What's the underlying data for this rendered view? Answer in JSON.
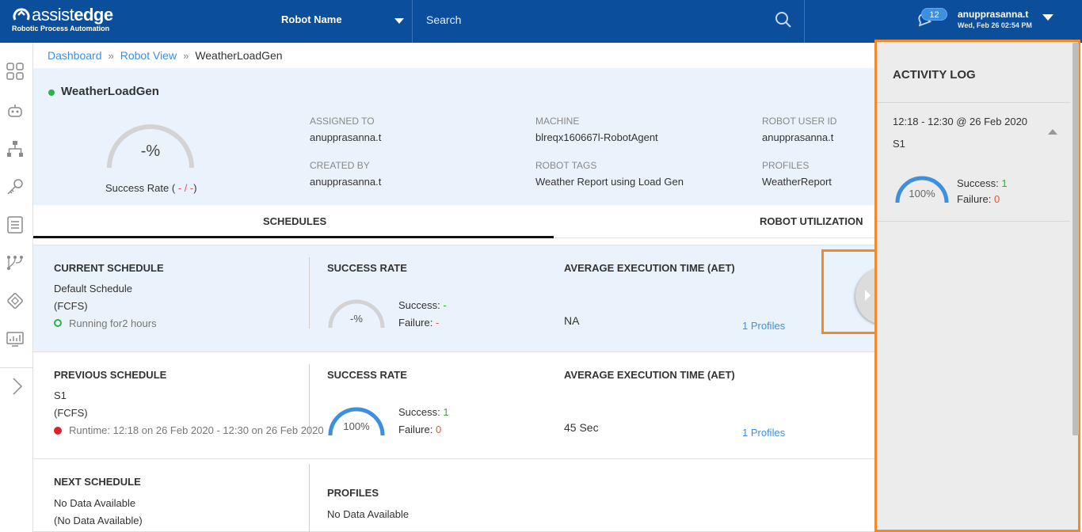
{
  "header": {
    "logo_thin": "assist",
    "logo_bold": "edge",
    "logo_subtitle": "Robotic Process Automation",
    "robot_selector_label": "Robot Name",
    "search_placeholder": "Search",
    "notification_count": "12",
    "user_name": "anupprasanna.t",
    "user_datetime": "Wed, Feb 26 02:54 PM",
    "brand_color": "#0b4f9c"
  },
  "sidebar": {
    "icons": [
      "dashboard-grid-icon",
      "robot-icon",
      "hierarchy-icon",
      "key-icon",
      "list-icon",
      "workflow-icon",
      "chip-icon",
      "monitor-chart-icon"
    ],
    "expand_icon": "chevron-right-icon"
  },
  "breadcrumb": {
    "items": [
      "Dashboard",
      "Robot View",
      "WeatherLoadGen"
    ],
    "separator": "»"
  },
  "robot": {
    "name": "WeatherLoadGen",
    "status_color": "#2ab24b",
    "gauge_value": "-%",
    "success_rate_label": "Success Rate (",
    "success_rate_ratio": " - / -",
    "success_rate_close": ")",
    "assigned_to_label": "ASSIGNED TO",
    "assigned_to": "anupprasanna.t",
    "created_by_label": "CREATED BY",
    "created_by": "anupprasanna.t",
    "machine_label": "MACHINE",
    "machine": "blreqx160667l-RobotAgent",
    "robot_tags_label": "ROBOT TAGS",
    "robot_tags": "Weather Report using Load Gen",
    "robot_user_id_label": "ROBOT USER ID",
    "robot_user_id": "anupprasanna.t",
    "profiles_label": "PROFILES",
    "profiles": "WeatherReport"
  },
  "tabs": [
    {
      "label": "SCHEDULES",
      "active": true
    },
    {
      "label": "ROBOT UTILIZATION",
      "active": false
    }
  ],
  "schedules": {
    "current": {
      "heading": "CURRENT SCHEDULE",
      "name": "Default Schedule",
      "policy": "(FCFS)",
      "status": "Running for2 hours",
      "status_color": "#2ab24b",
      "rate_heading": "SUCCESS RATE",
      "gauge_value": "-%",
      "success_label": "Success:",
      "success_value": "-",
      "failure_label": "Failure:",
      "failure_value": "-",
      "aet_heading": "AVERAGE EXECUTION TIME (AET)",
      "aet_value": "NA",
      "profiles_link": "1 Profiles"
    },
    "previous": {
      "heading": "PREVIOUS SCHEDULE",
      "name": "S1",
      "policy": "(FCFS)",
      "status": "Runtime: 12:18 on 26 Feb 2020 - 12:30 on 26 Feb 2020",
      "status_color": "#e0212b",
      "rate_heading": "SUCCESS RATE",
      "gauge_value": "100%",
      "gauge_fraction": 1.0,
      "success_label": "Success:",
      "success_value": "1",
      "failure_label": "Failure:",
      "failure_value": "0",
      "aet_heading": "AVERAGE EXECUTION TIME (AET)",
      "aet_value": "45 Sec",
      "profiles_link": "1 Profiles"
    },
    "next": {
      "heading": "NEXT SCHEDULE",
      "name": "No Data Available",
      "policy": "(No Data Available)",
      "profiles_heading": "PROFILES",
      "profiles_value": "No Data Available"
    }
  },
  "activity_log": {
    "title": "ACTIVITY LOG",
    "entry_time": "12:18 - 12:30 @ 26 Feb 2020",
    "entry_name": "S1",
    "gauge_value": "100%",
    "gauge_fraction": 1.0,
    "success_label": "Success:",
    "success_value": "1",
    "failure_label": "Failure:",
    "failure_value": "0",
    "highlight_color": "#f08a2b"
  }
}
